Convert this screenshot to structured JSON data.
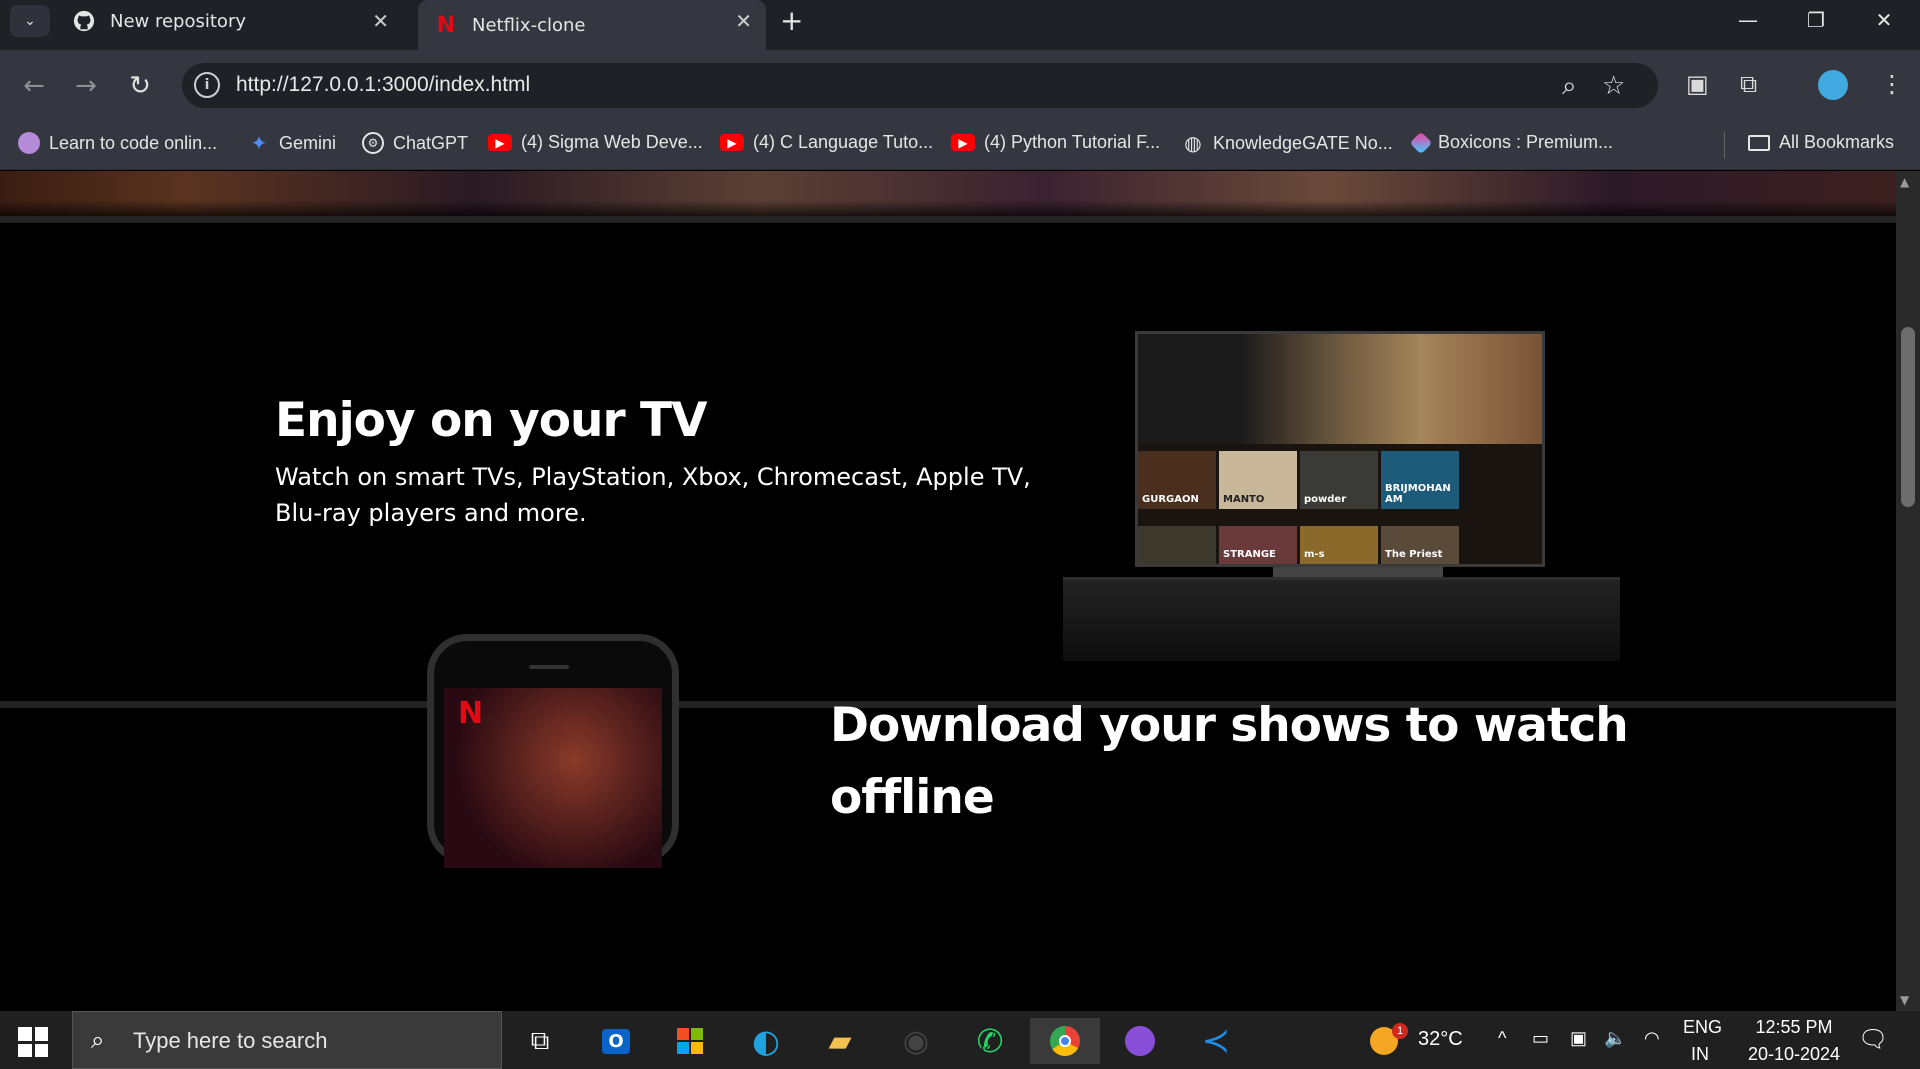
{
  "browser": {
    "tabs": [
      {
        "title": "New repository",
        "icon": "github-icon"
      },
      {
        "title": "Netflix-clone",
        "icon": "netflix-icon"
      }
    ],
    "url": "http://127.0.0.1:3000/index.html",
    "bookmarks": [
      {
        "label": "Learn to code onlin...",
        "icon": "avatar-icon"
      },
      {
        "label": "Gemini",
        "icon": "gemini-icon"
      },
      {
        "label": "ChatGPT",
        "icon": "chatgpt-icon"
      },
      {
        "label": "(4) Sigma Web Deve...",
        "icon": "youtube-icon"
      },
      {
        "label": "(4) C Language Tuto...",
        "icon": "youtube-icon"
      },
      {
        "label": "(4) Python Tutorial F...",
        "icon": "youtube-icon"
      },
      {
        "label": "KnowledgeGATE No...",
        "icon": "globe-icon"
      },
      {
        "label": "Boxicons : Premium...",
        "icon": "boxicons-icon"
      }
    ],
    "all_bookmarks": "All Bookmarks"
  },
  "page": {
    "tv_section": {
      "title": "Enjoy on your TV",
      "text": "Watch on smart TVs, PlayStation, Xbox, Chromecast, Apple TV, Blu-ray players and more.",
      "tv_tiles_row1": [
        "GURGAON",
        "MANTO",
        "powder",
        "BRIJMOHAN AM"
      ],
      "tv_tiles_row2": [
        "",
        "STRANGE",
        "m-s",
        "The Priest"
      ]
    },
    "download_section": {
      "title": "Download your shows to watch offline"
    }
  },
  "taskbar": {
    "search_placeholder": "Type here to search",
    "weather": "32°C",
    "weather_badge": "1",
    "lang1": "ENG",
    "lang2": "IN",
    "time": "12:55 PM",
    "date": "20-10-2024"
  }
}
